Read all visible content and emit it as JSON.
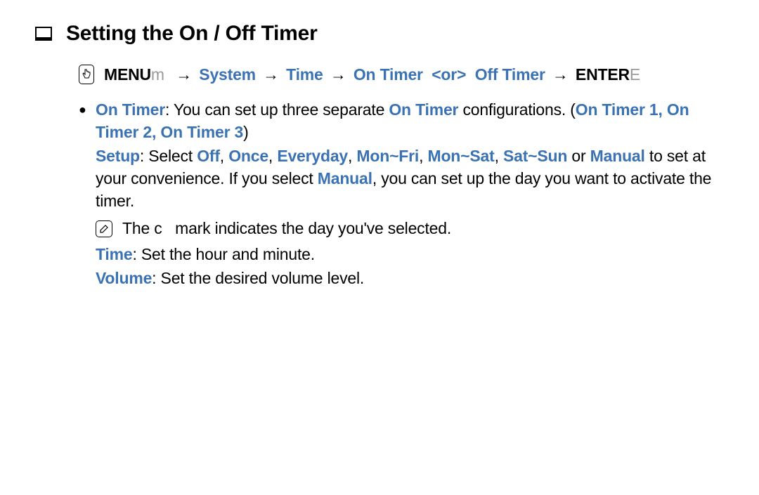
{
  "heading": "Setting the On / Off Timer",
  "nav": {
    "menu_label": "MENU",
    "menu_suffix": "m",
    "arrow": "→",
    "system": "System",
    "time": "Time",
    "ontimer": "On Timer",
    "or": "<or>",
    "offtimer": "Off Timer",
    "enter_label": "ENTER",
    "enter_suffix": "E"
  },
  "on_timer_label": "On Timer",
  "on_timer_desc1": ": You can set up three separate ",
  "on_timer_label2": "On Timer",
  "on_timer_desc2": " configurations. (",
  "on_timer_1": "On Timer 1",
  "comma": ", ",
  "on_timer_2": "On Timer 2",
  "on_timer_3": "On Timer 3",
  "close_paren": ")",
  "setup_label": "Setup",
  "setup_desc1": ": Select ",
  "off": "Off",
  "once": "Once",
  "everyday": "Everyday",
  "monfri": "Mon~Fri",
  "monsat": "Mon~Sat",
  "satsun": "Sat~Sun",
  "or_word": " or ",
  "manual": "Manual",
  "setup_desc2": " to set at your convenience. If you select ",
  "manual2": "Manual",
  "setup_desc3": ", you can set up the day you want to activate the timer.",
  "note_pre": "The ",
  "note_c": "c",
  "note_post": " mark indicates the day you've selected.",
  "time_label": "Time",
  "time_desc": ": Set the hour and minute.",
  "volume_label": "Volume",
  "volume_desc": ": Set the desired volume level."
}
